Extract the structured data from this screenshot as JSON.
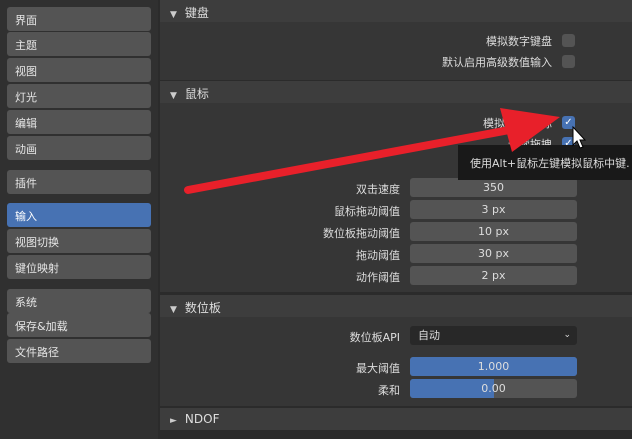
{
  "sidebar": {
    "items": [
      "界面",
      "主题",
      "视图",
      "灯光",
      "编辑",
      "动画",
      "插件",
      "输入",
      "视图切换",
      "键位映射",
      "系统",
      "保存&加载",
      "文件路径"
    ],
    "selected": "输入"
  },
  "keyboard": {
    "title": "键盘",
    "emulate_numpad": "模拟数字键盘",
    "default_adv_input": "默认启用高级数值输入"
  },
  "mouse": {
    "title": "鼠标",
    "emulate_3btn": "模拟 3 键鼠标",
    "continuous_grab": "连续拖拽",
    "double_click_label": "双击速度",
    "double_click": "350",
    "drag_label": "鼠标拖动阈值",
    "drag": "3 px",
    "tablet_drag_label": "数位板拖动阈值",
    "tablet_drag": "10 px",
    "drag_thresh_label": "拖动阈值",
    "drag_thresh": "30 px",
    "motion_label": "动作阈值",
    "motion": "2 px"
  },
  "tooltip": "使用Alt+鼠标左键模拟鼠标中键.",
  "tablet": {
    "title": "数位板",
    "api_label": "数位板API",
    "api": "自动",
    "max_label": "最大阈值",
    "max": "1.000",
    "max_fill": 1.0,
    "soft_label": "柔和",
    "soft": "0.00",
    "soft_fill": 0.5
  },
  "ndof": {
    "title": "NDOF"
  },
  "colors": {
    "accent": "#4772b3",
    "arrow": "#e8202a"
  }
}
